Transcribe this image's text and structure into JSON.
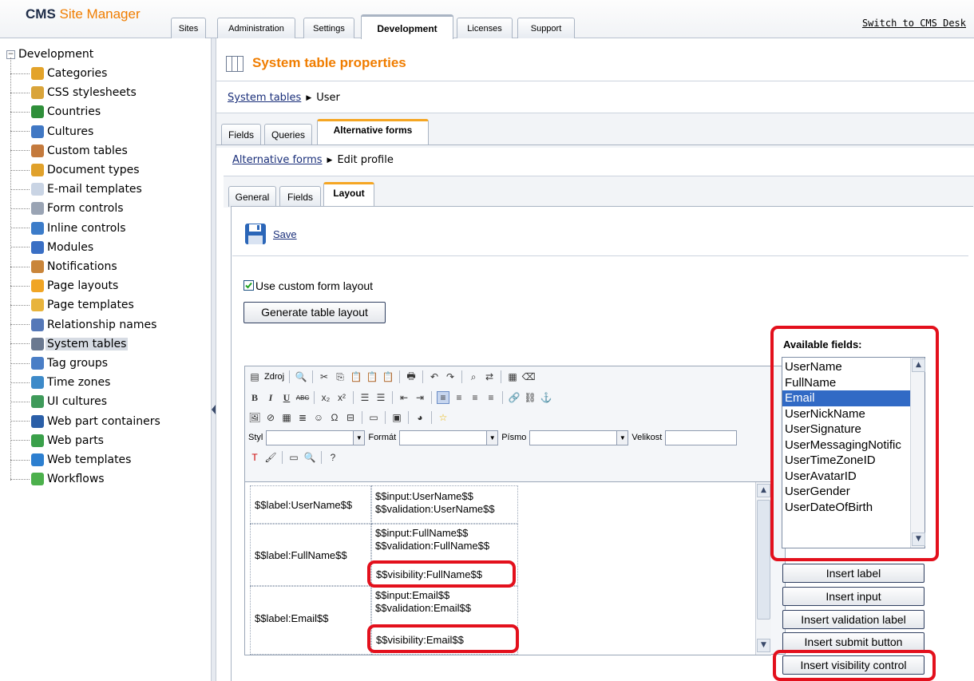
{
  "header": {
    "brand_main": "CMS",
    "brand_sub": "Site Manager",
    "tabs": [
      "Sites",
      "Administration",
      "Settings",
      "Development",
      "Licenses",
      "Support"
    ],
    "active_tab": "Development",
    "switch_link": "Switch to CMS Desk"
  },
  "sidebar": {
    "root": "Development",
    "items": [
      {
        "label": "Categories",
        "icon": "folder-cookie-icon",
        "color": "#e3a32a"
      },
      {
        "label": "CSS stylesheets",
        "icon": "paint-brush-icon",
        "color": "#d9a43a"
      },
      {
        "label": "Countries",
        "icon": "globe-icon",
        "color": "#2f8f3a"
      },
      {
        "label": "Cultures",
        "icon": "culture-globe-icon",
        "color": "#4178c4"
      },
      {
        "label": "Custom tables",
        "icon": "table-icon",
        "color": "#c47a3d"
      },
      {
        "label": "Document types",
        "icon": "document-stack-icon",
        "color": "#e0a12b"
      },
      {
        "label": "E-mail templates",
        "icon": "envelope-icon",
        "color": "#c9d4e4"
      },
      {
        "label": "Form controls",
        "icon": "form-control-icon",
        "color": "#9aa4b4"
      },
      {
        "label": "Inline controls",
        "icon": "inline-control-icon",
        "color": "#3c7cc9"
      },
      {
        "label": "Modules",
        "icon": "modules-icon",
        "color": "#3a6fc4"
      },
      {
        "label": "Notifications",
        "icon": "notification-icon",
        "color": "#c9853a"
      },
      {
        "label": "Page layouts",
        "icon": "page-layout-icon",
        "color": "#f0a525"
      },
      {
        "label": "Page templates",
        "icon": "page-template-icon",
        "color": "#e8b43c"
      },
      {
        "label": "Relationship names",
        "icon": "relationship-icon",
        "color": "#5578b8"
      },
      {
        "label": "System tables",
        "icon": "system-table-icon",
        "color": "#6b7990"
      },
      {
        "label": "Tag groups",
        "icon": "tag-icon",
        "color": "#4a7ec6"
      },
      {
        "label": "Time zones",
        "icon": "clock-globe-icon",
        "color": "#3d8ac9"
      },
      {
        "label": "UI cultures",
        "icon": "ui-culture-icon",
        "color": "#3f9a5a"
      },
      {
        "label": "Web part containers",
        "icon": "container-icon",
        "color": "#2b5fa8"
      },
      {
        "label": "Web parts",
        "icon": "web-parts-icon",
        "color": "#3aa04a"
      },
      {
        "label": "Web templates",
        "icon": "web-template-icon",
        "color": "#2d7fd0"
      },
      {
        "label": "Workflows",
        "icon": "checkmark-icon",
        "color": "#4cb04c"
      }
    ],
    "selected": "System tables"
  },
  "page": {
    "title": "System table properties",
    "breadcrumb_link": "System tables",
    "breadcrumb_current": "User",
    "tabs": [
      "Fields",
      "Queries",
      "Alternative forms"
    ],
    "active_tab": "Alternative forms",
    "sub_breadcrumb_link": "Alternative forms",
    "sub_breadcrumb_current": "Edit profile",
    "sub_tabs": [
      "General",
      "Fields",
      "Layout"
    ],
    "active_sub_tab": "Layout",
    "save_label": "Save",
    "checkbox_label": "Use custom form layout",
    "checkbox_checked": true,
    "generate_button": "Generate table layout"
  },
  "editor": {
    "source_label": "Zdroj",
    "style_label": "Styl",
    "format_label": "Formát",
    "font_label": "Písmo",
    "size_label": "Velikost",
    "rows": [
      {
        "label": "$$label:UserName$$",
        "input": "$$input:UserName$$",
        "validation": "$$validation:UserName$$"
      },
      {
        "label": "$$label:FullName$$",
        "input": "$$input:FullName$$",
        "validation": "$$validation:FullName$$",
        "visibility": "$$visibility:FullName$$"
      },
      {
        "label": "$$label:Email$$",
        "input": "$$input:Email$$",
        "validation": "$$validation:Email$$",
        "visibility": "$$visibility:Email$$"
      }
    ]
  },
  "available_fields": {
    "label": "Available fields:",
    "items": [
      "UserName",
      "FullName",
      "Email",
      "UserNickName",
      "UserSignature",
      "UserMessagingNotific",
      "UserTimeZoneID",
      "UserAvatarID",
      "UserGender",
      "UserDateOfBirth"
    ],
    "selected": "Email"
  },
  "insert_buttons": {
    "label": "Insert label",
    "input": "Insert input",
    "validation": "Insert validation label",
    "submit": "Insert submit button",
    "visibility": "Insert visibility control"
  },
  "colors": {
    "brand": "#f07d00",
    "highlight": "#e3101c",
    "selection": "#316ac5"
  }
}
